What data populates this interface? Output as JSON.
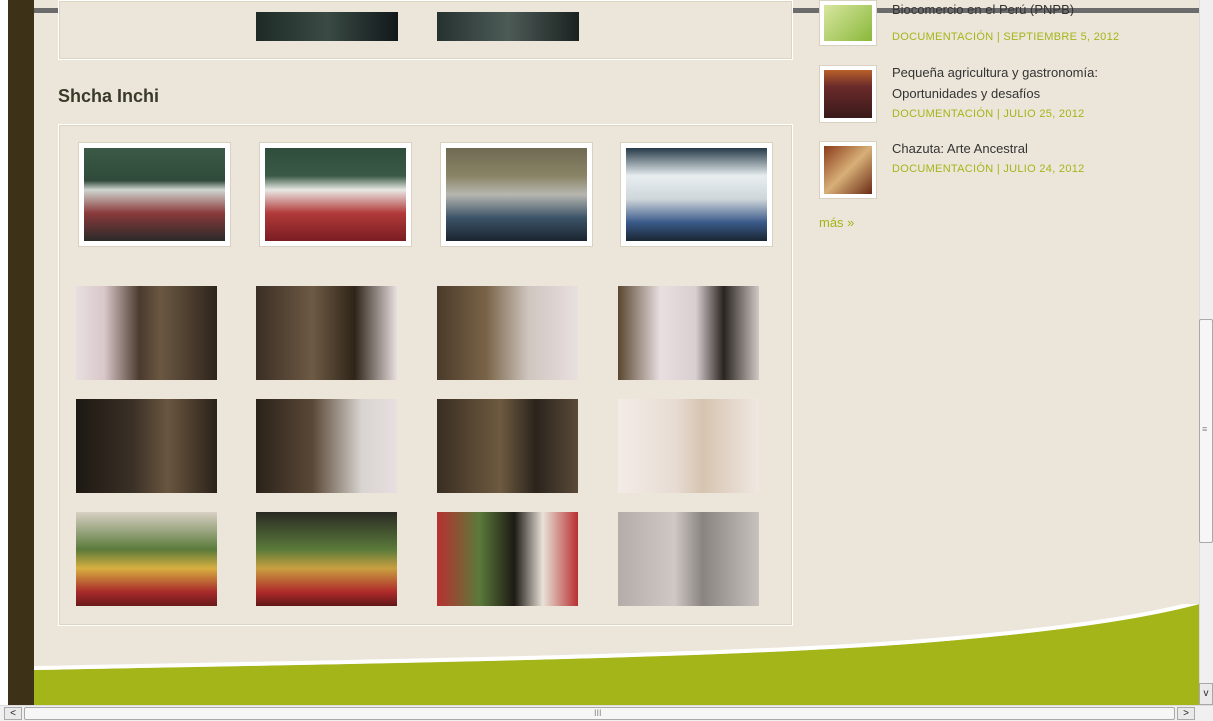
{
  "gallery": {
    "title": "Shcha Inchi"
  },
  "sidebar": {
    "items": [
      {
        "title": "Biocomercio en el Perú (PNPB)",
        "meta": "DOCUMENTACIÓN | SEPTIEMBRE 5, 2012"
      },
      {
        "title_line1": "Pequeña agricultura y gastronomía:",
        "title_line2": "Oportunidades y desafíos",
        "meta": "DOCUMENTACIÓN | JULIO 25, 2012"
      },
      {
        "title": "Chazuta: Arte Ancestral",
        "meta": "DOCUMENTACIÓN | JULIO 24, 2012"
      }
    ],
    "more_label": "más »"
  },
  "colors": {
    "background": "#ece6da",
    "accent_green": "#a3b518",
    "dark_side": "#3d3218"
  },
  "scrollbar": {
    "down_arrow": "v",
    "left_arrow": "<",
    "right_arrow": ">",
    "grip": "≡",
    "h_grip": "III"
  }
}
